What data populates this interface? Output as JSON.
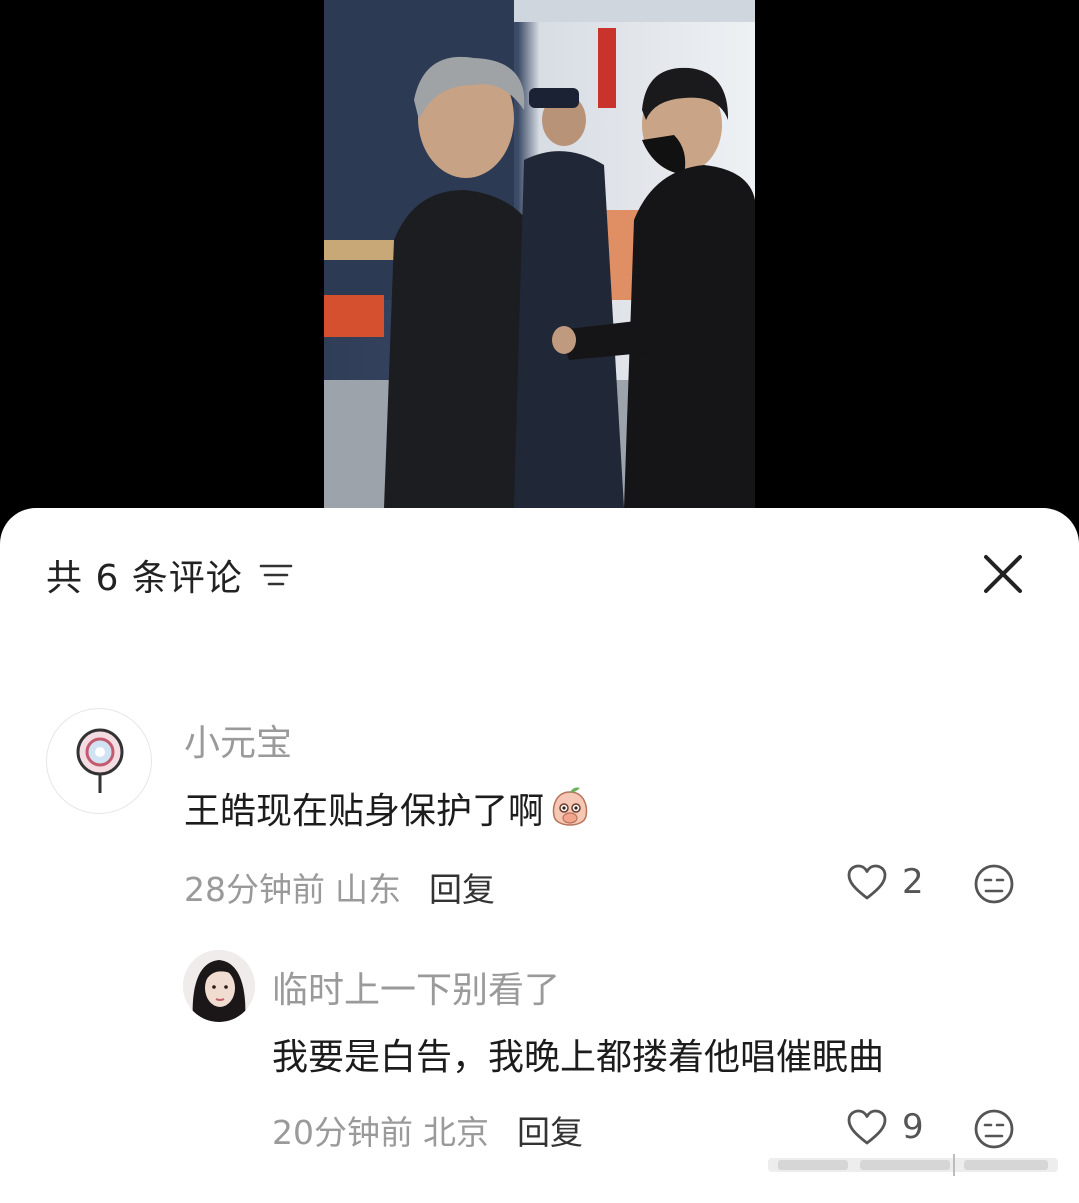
{
  "comments_panel": {
    "count_title": "共 6 条评论",
    "filter_icon": "filter-icon",
    "close_icon": "close-icon"
  },
  "comments": [
    {
      "username": "小元宝",
      "text": "王皓现在贴身保护了啊",
      "emoji": "peach-cover-mouth-emoji",
      "time": "28分钟前",
      "location": "山东",
      "reply_label": "回复",
      "likes": "2"
    },
    {
      "username": "临时上一下别看了",
      "text": "我要是白告，我晚上都搂着他唱催眠曲",
      "time": "20分钟前",
      "location": "北京",
      "reply_label": "回复",
      "likes": "9"
    }
  ],
  "colors": {
    "sheet_bg": "#ffffff",
    "username": "#9a9a9a",
    "content": "#1c1c1c",
    "background": "#000000"
  }
}
